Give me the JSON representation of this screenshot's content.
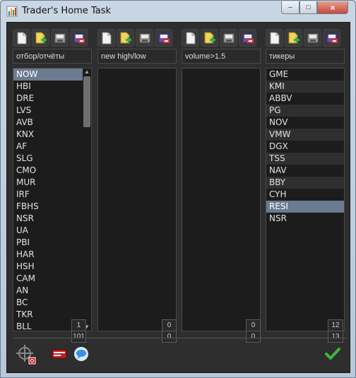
{
  "window": {
    "title": "Trader's Home Task",
    "close_label": "×",
    "max_label": "□",
    "min_label": "–"
  },
  "panels": [
    {
      "name": "отбор/отчёты",
      "counter_top": "1",
      "counter_bottom": "101",
      "items": [
        "NOW",
        "HBI",
        "DRE",
        "LVS",
        "AVB",
        "KNX",
        "AF",
        "SLG",
        "CMO",
        "MUR",
        "IRF",
        "FBHS",
        "NSR",
        "UA",
        "PBI",
        "HAR",
        "HSH",
        "CAM",
        "AN",
        "BC",
        "TKR",
        "BLL"
      ],
      "selected": 0
    },
    {
      "name": "new high/low",
      "counter_top": "0",
      "counter_bottom": "0",
      "items": []
    },
    {
      "name": "volume>1.5",
      "counter_top": "0",
      "counter_bottom": "0",
      "items": []
    },
    {
      "name": "тикеры",
      "counter_top": "12",
      "counter_bottom": "13",
      "items": [
        "GME",
        "KMI",
        "ABBV",
        "PG",
        "NOV",
        "VMW",
        "DGX",
        "TSS",
        "NAV",
        "BBY",
        "CYH",
        "RESI",
        "NSR"
      ],
      "selected": 11
    }
  ],
  "icons": {
    "toolbar": [
      "new-document-icon",
      "add-document-icon",
      "save-disk-icon",
      "save-as-disk-icon"
    ],
    "bottom": [
      "crosshair-target-icon",
      "ticker-tape-icon",
      "chat-bubble-icon",
      "checkmark-icon"
    ]
  },
  "colors": {
    "selection": "#6b7b90",
    "background": "#2e2e2e",
    "check": "#3cb83c"
  }
}
